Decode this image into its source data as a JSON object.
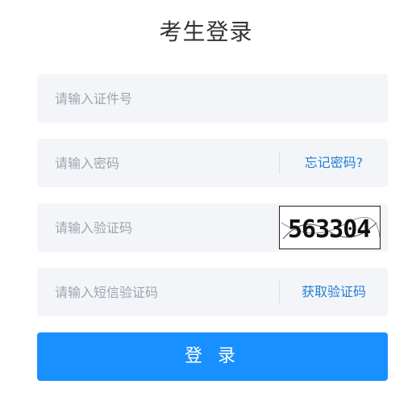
{
  "page_title": "考生登录",
  "form": {
    "id_number": {
      "placeholder": "请输入证件号",
      "value": ""
    },
    "password": {
      "placeholder": "请输入密码",
      "value": "",
      "forgot_link": "忘记密码?"
    },
    "captcha": {
      "placeholder": "请输入验证码",
      "value": "",
      "image_text": "563304"
    },
    "sms_code": {
      "placeholder": "请输入短信验证码",
      "value": "",
      "get_code_link": "获取验证码"
    }
  },
  "login_button": "登 录",
  "colors": {
    "primary": "#1890ff",
    "link": "#1f7fd6",
    "field_bg": "#f4f5f9"
  }
}
